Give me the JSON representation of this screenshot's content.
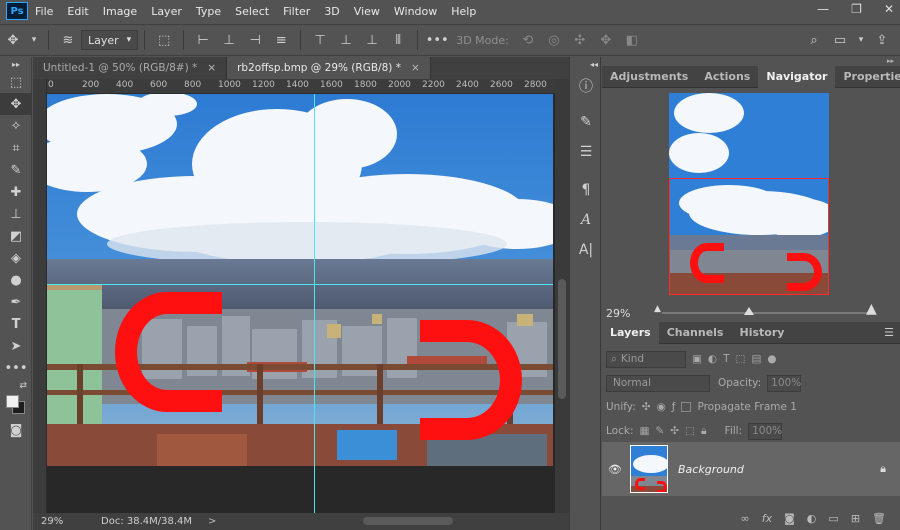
{
  "app": {
    "logo": "Ps"
  },
  "menu": [
    "File",
    "Edit",
    "Image",
    "Layer",
    "Type",
    "Select",
    "Filter",
    "3D",
    "View",
    "Window",
    "Help"
  ],
  "window_controls": {
    "minimize": "—",
    "restore": "❐",
    "close": "✕"
  },
  "options_bar": {
    "layer_select": "Layer",
    "mode_label": "3D Mode:",
    "more": "•••"
  },
  "tabs": [
    {
      "label": "Untitled-1 @ 50% (RGB/8#) *",
      "close": "×",
      "active": false
    },
    {
      "label": "rb2offsp.bmp @ 29% (RGB/8) *",
      "close": "×",
      "active": true
    }
  ],
  "ruler_ticks": [
    "0",
    "200",
    "400",
    "600",
    "800",
    "1000",
    "1200",
    "1400",
    "1600",
    "1800",
    "2000",
    "2200",
    "2400",
    "2600",
    "2800",
    "3000"
  ],
  "status": {
    "zoom": "29%",
    "doc": "Doc: 38.4M/38.4M",
    "arrow": ">"
  },
  "panel_top": {
    "tabs": [
      "Adjustments",
      "Actions",
      "Navigator",
      "Properties"
    ],
    "active_tab": "Navigator",
    "zoom": "29%"
  },
  "panel_layers": {
    "tabs": [
      "Layers",
      "Channels",
      "History"
    ],
    "active_tab": "Layers",
    "kind": "Kind",
    "blend_mode": "Normal",
    "opacity_label": "Opacity:",
    "opacity_value": "100%",
    "unify_label": "Unify:",
    "propagate_label": "Propagate Frame 1",
    "lock_label": "Lock:",
    "fill_label": "Fill:",
    "fill_value": "100%",
    "layer_name": "Background"
  },
  "colors": {
    "sky": "#2f7fd6",
    "cloud": "#f4f7fb",
    "magnet_red": "#ff1010",
    "guide": "#4be6f0",
    "nav_box": "#ff2a2a"
  }
}
